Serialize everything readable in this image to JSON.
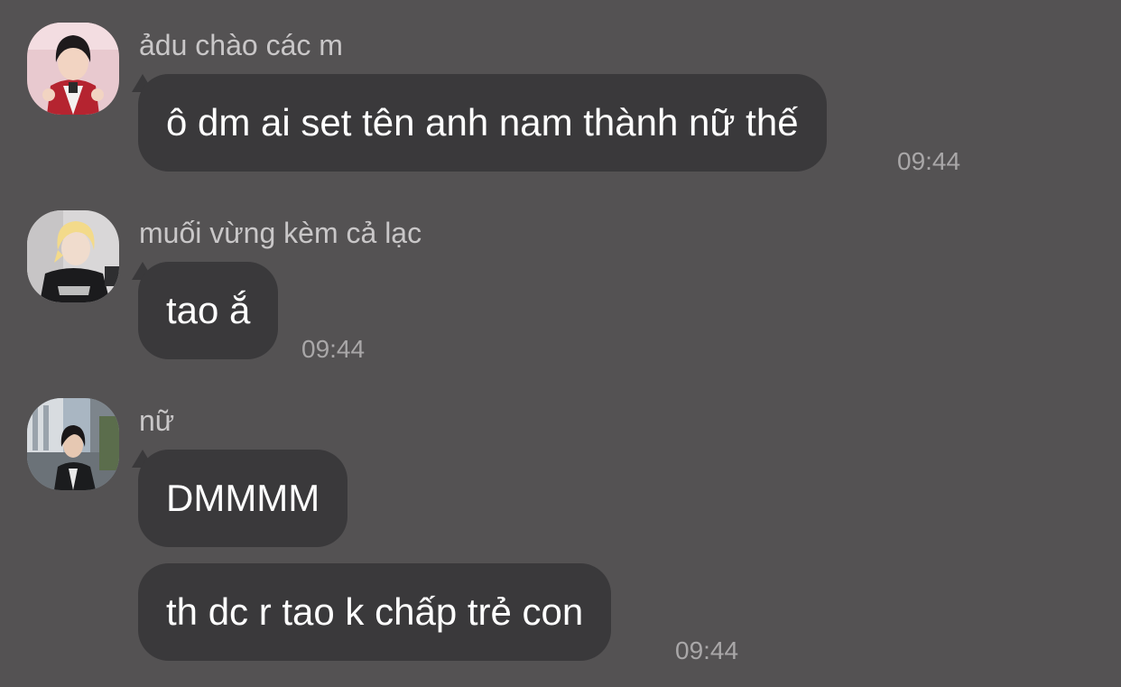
{
  "messages": [
    {
      "sender": "ảdu chào các m",
      "avatar_icon": "user-avatar-icon",
      "bubbles": [
        "ô dm ai set tên anh nam thành nữ thế"
      ],
      "time": "09:44"
    },
    {
      "sender": "muối vừng kèm cả lạc",
      "avatar_icon": "user-avatar-icon",
      "bubbles": [
        "tao ắ"
      ],
      "time": "09:44"
    },
    {
      "sender": "nữ",
      "avatar_icon": "user-avatar-icon",
      "bubbles": [
        "DMMMM",
        "th dc r tao k chấp trẻ con"
      ],
      "time": "09:44"
    }
  ],
  "colors": {
    "background": "#545253",
    "bubble": "#3a393b",
    "text": "#ffffff",
    "sender": "#c9c7c8",
    "time": "#a9a7a8"
  }
}
